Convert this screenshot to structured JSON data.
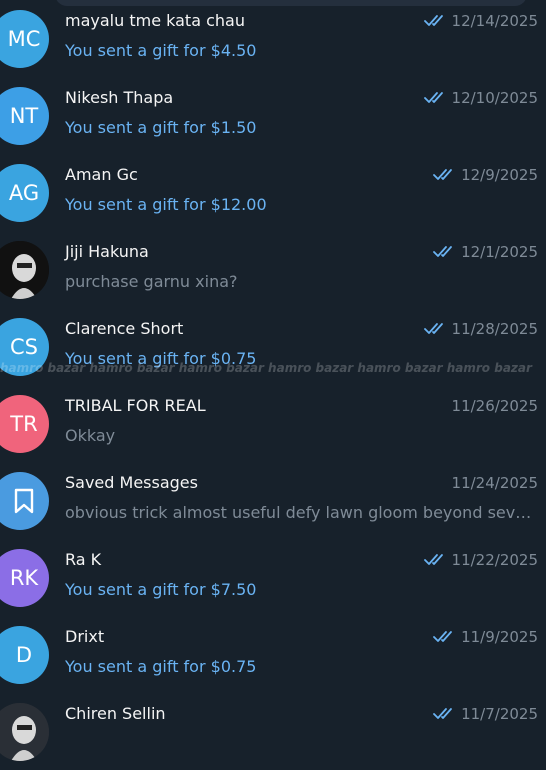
{
  "chats": [
    {
      "initials": "MC",
      "avatar_type": "initials",
      "color": "#3aa4e0",
      "name": "mayalu tme kata chau",
      "preview": "You sent a gift for $4.50",
      "preview_style": "gift",
      "date": "12/14/2025",
      "read": true
    },
    {
      "initials": "NT",
      "avatar_type": "initials",
      "color": "#3d9fe6",
      "name": "Nikesh Thapa",
      "preview": "You sent a gift for $1.50",
      "preview_style": "gift",
      "date": "12/10/2025",
      "read": true
    },
    {
      "initials": "AG",
      "avatar_type": "initials",
      "color": "#3aa4e0",
      "name": "Aman Gc",
      "preview": "You sent a gift for $12.00",
      "preview_style": "gift",
      "date": "12/9/2025",
      "read": true
    },
    {
      "initials": "",
      "avatar_type": "photo",
      "color": "#111111",
      "name": "Jiji Hakuna",
      "preview": "purchase garnu xina?",
      "preview_style": "plain",
      "date": "12/1/2025",
      "read": true
    },
    {
      "initials": "CS",
      "avatar_type": "initials",
      "color": "#3aa4e0",
      "name": "Clarence Short",
      "preview": "You sent a gift for $0.75",
      "preview_style": "gift",
      "date": "11/28/2025",
      "read": true
    },
    {
      "initials": "TR",
      "avatar_type": "initials",
      "color": "#f0647c",
      "name": "TRIBAL FOR REAL",
      "preview": "Okkay",
      "preview_style": "plain",
      "date": "11/26/2025",
      "read": false
    },
    {
      "initials": "",
      "avatar_type": "saved",
      "color": "#4a9be0",
      "name": "Saved Messages",
      "preview": "obvious trick almost useful defy lawn gloom beyond seven el...",
      "preview_style": "plain",
      "date": "11/24/2025",
      "read": false
    },
    {
      "initials": "RK",
      "avatar_type": "initials",
      "color": "#8b6ee6",
      "name": "Ra K",
      "preview": "You sent a gift for $7.50",
      "preview_style": "gift",
      "date": "11/22/2025",
      "read": true
    },
    {
      "initials": "D",
      "avatar_type": "initials",
      "color": "#3aa4e0",
      "name": "Drixt",
      "preview": "You sent a gift for $0.75",
      "preview_style": "gift",
      "date": "11/9/2025",
      "read": true
    },
    {
      "initials": "",
      "avatar_type": "photo",
      "color": "#2a2f36",
      "name": "Chiren Sellin",
      "preview": "",
      "preview_style": "plain",
      "date": "11/7/2025",
      "read": true
    }
  ],
  "watermark": "hamro bazar  hamro bazar  hamro bazar  hamro bazar  hamro bazar  hamro bazar",
  "colors": {
    "background": "#17212b",
    "accent": "#6ab3f3",
    "muted": "#7f8b97"
  }
}
